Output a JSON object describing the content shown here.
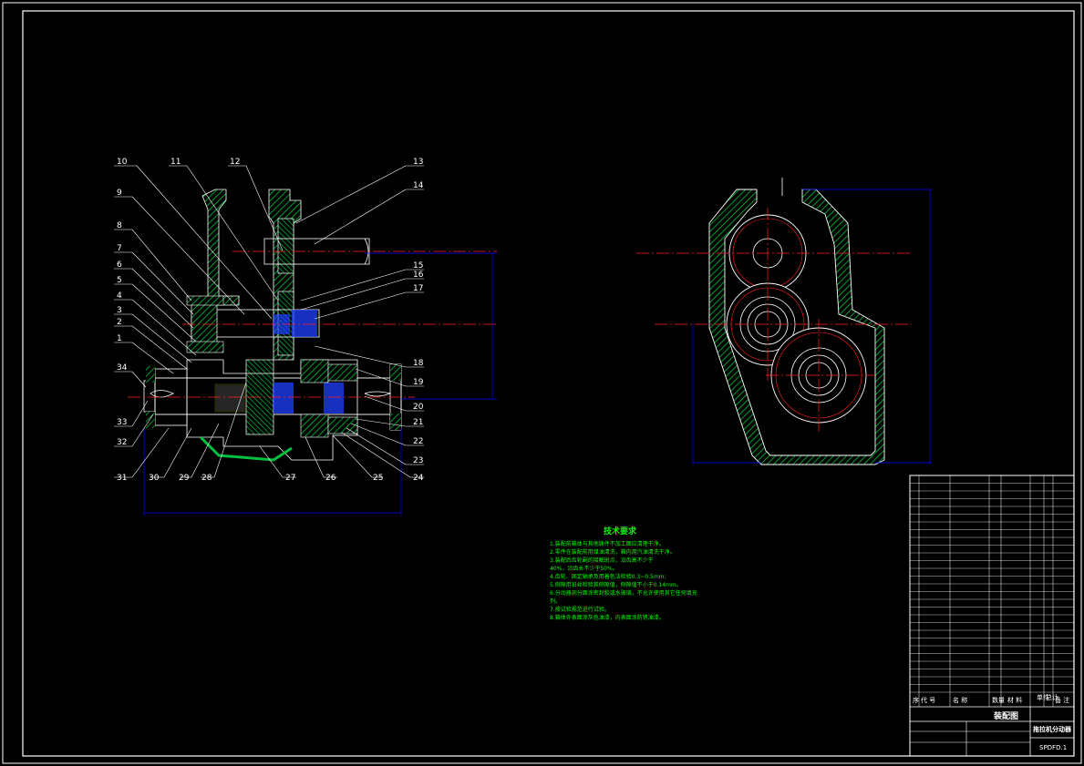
{
  "drawing": {
    "part_numbers_top": [
      "10",
      "11",
      "12",
      "13",
      "14"
    ],
    "part_numbers_left": [
      "9",
      "8",
      "7",
      "6",
      "5",
      "4",
      "3",
      "2",
      "1",
      "34",
      "33",
      "32"
    ],
    "part_numbers_right": [
      "15",
      "16",
      "17",
      "18",
      "19",
      "20",
      "21",
      "22",
      "23"
    ],
    "part_numbers_bottom": [
      "31",
      "30",
      "29",
      "28",
      "27",
      "26",
      "25",
      "24"
    ]
  },
  "tech_requirements": {
    "title": "技术要求",
    "lines": [
      "1.装配前箱体与其他铸件不加工面应清理干净。",
      "2.零件在装配前用煤油清洗，箱内用汽油清洗干净。",
      "3.装配后齿轮副的接触斑点，沿齿高不少于",
      "40%，沿齿长不少于50%。",
      "4.齿轮、固定轴承及用着色法检验0.3~0.5mm;",
      "5.侧隙用铅丝检验其侧隙值，侧隙值不小于0.14mm。",
      "6.分动器剖分面涂密封胶或水玻璃，不允许使用其它任何填充",
      "剂。",
      "7.按试验规范进行试验。",
      "8.箱体外表面涂灰色油漆，内表面涂防锈油漆。"
    ]
  },
  "title_block": {
    "drawing_type": "装配图",
    "drawing_name": "拖拉机分动器",
    "drawing_number": "SPDFD.1",
    "header_row": [
      "序",
      "代 号",
      "名 称",
      "数量",
      "材 料",
      "单件",
      "总计",
      "备 注"
    ]
  },
  "colors": {
    "background": "#000000",
    "outline": "#ffffff",
    "section_hatch": "#00c040",
    "center_line": "#ff2020",
    "dimension": "#0000ff",
    "text_green": "#00ff00"
  }
}
